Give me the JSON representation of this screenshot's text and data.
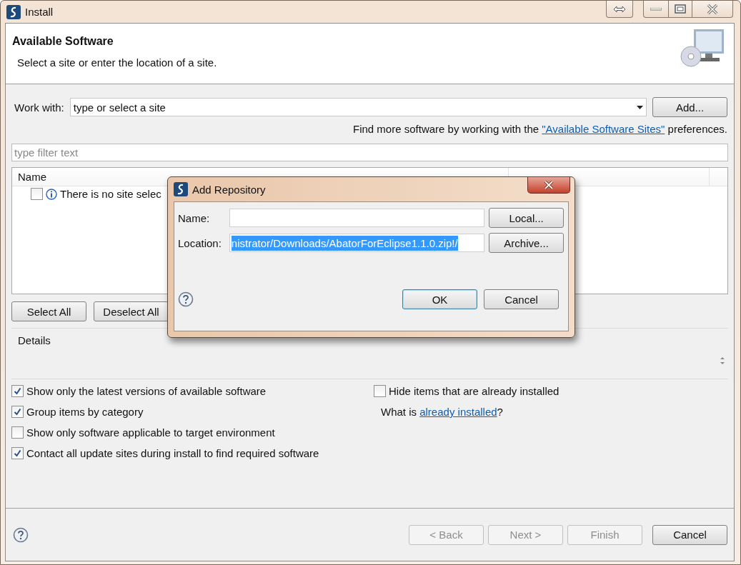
{
  "window": {
    "title": "Install"
  },
  "header": {
    "title": "Available Software",
    "description": "Select a site or enter the location of a site."
  },
  "work_with": {
    "label": "Work with:",
    "value": "type or select a site",
    "add_button": "Add..."
  },
  "sites_hint": {
    "text": "Find more software by working with the",
    "link": "\"Available Software Sites\"",
    "suffix": "preferences."
  },
  "filter": {
    "placeholder": "type filter text"
  },
  "table": {
    "columns": [
      "Name"
    ],
    "rows": [
      {
        "checked": false,
        "text": "There is no site selec"
      }
    ]
  },
  "selection_buttons": [
    "Select All",
    "Deselect All"
  ],
  "details": {
    "label": "Details"
  },
  "options_left": [
    {
      "label": "Show only the latest versions of available software",
      "checked": true
    },
    {
      "label": "Group items by category",
      "checked": true
    },
    {
      "label": "Show only software applicable to target environment",
      "checked": false
    },
    {
      "label": "Contact all update sites during install to find required software",
      "checked": true
    }
  ],
  "options_right": [
    {
      "label": "Hide items that are already installed",
      "checked": false
    }
  ],
  "installed_link": {
    "prefix": "What is",
    "link": "already installed",
    "suffix": "?"
  },
  "footer_buttons": [
    {
      "label": "< Back",
      "disabled": true
    },
    {
      "label": "Next >",
      "disabled": true
    },
    {
      "label": "Finish",
      "disabled": true
    },
    {
      "label": "Cancel",
      "disabled": false
    }
  ],
  "dialog": {
    "title": "Add Repository",
    "fields": [
      {
        "label": "Name:",
        "button": "Local..."
      },
      {
        "label": "Location:",
        "value": "nistrator/Downloads/AbatorForEclipse1.1.0.zip!/",
        "highlighted": true,
        "button": "Archive..."
      }
    ],
    "buttons": [
      {
        "label": "OK",
        "default": true
      },
      {
        "label": "Cancel",
        "default": false
      }
    ]
  }
}
